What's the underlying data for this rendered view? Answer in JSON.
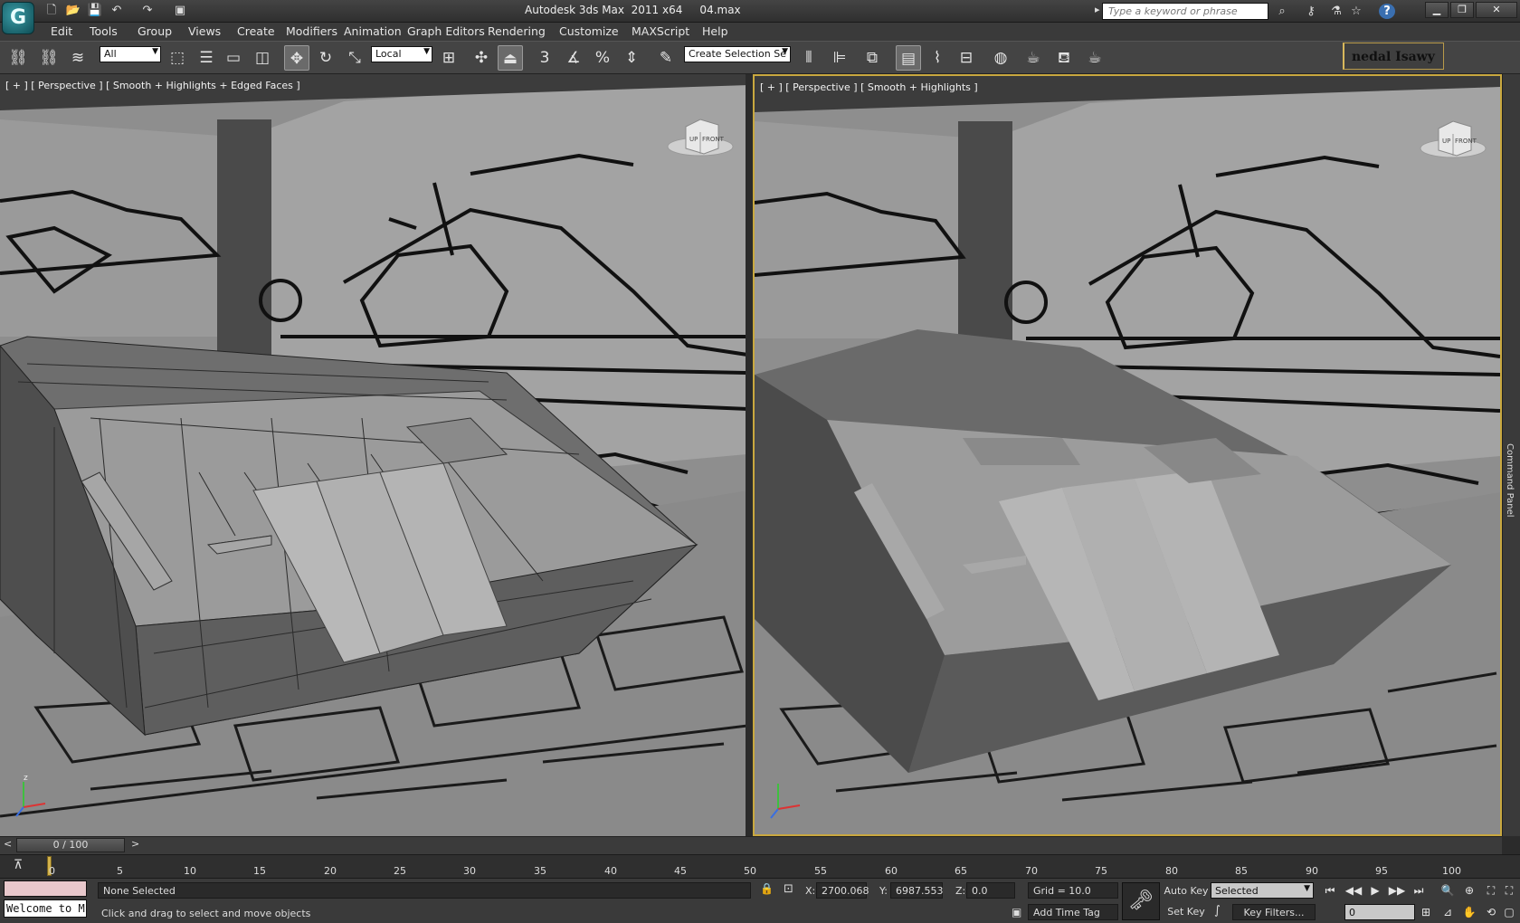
{
  "window": {
    "title": "Autodesk 3ds Max  2011 x64     04.max",
    "search_placeholder": "Type a keyword or phrase",
    "app_logo": "3ds-max-logo"
  },
  "menu": [
    "Edit",
    "Tools",
    "Group",
    "Views",
    "Create",
    "Modifiers",
    "Animation",
    "Graph Editors",
    "Rendering",
    "Customize",
    "MAXScript",
    "Help"
  ],
  "toolbar": {
    "selection_filter": "All",
    "reference_coord": "Local",
    "named_selection": "Create Selection Se",
    "user_label": "nedal Isawy"
  },
  "viewports": {
    "left_label": "[ + ] [ Perspective ] [ Smooth + Highlights + Edged Faces ]",
    "right_label": "[ + ] [ Perspective ] [ Smooth + Highlights ]",
    "viewcube_top": "UP",
    "viewcube_front": "FRONT",
    "axis_z": "z"
  },
  "command_panel_label": "Command Panel",
  "timeline": {
    "current": "0 / 100",
    "ticks": [
      "0",
      "5",
      "10",
      "15",
      "20",
      "25",
      "30",
      "35",
      "40",
      "45",
      "50",
      "55",
      "60",
      "65",
      "70",
      "75",
      "80",
      "85",
      "90",
      "95",
      "100"
    ]
  },
  "status": {
    "maxscript_listener": "Welcome to M",
    "selection": "None Selected",
    "prompt": "Click and drag to select and move objects",
    "x_label": "X:",
    "x_value": "2700.068",
    "y_label": "Y:",
    "y_value": "6987.553",
    "z_label": "Z:",
    "z_value": "0.0",
    "grid": "Grid = 10.0",
    "add_time_tag": "Add Time Tag",
    "auto_key": "Auto Key",
    "set_key": "Set Key",
    "key_mode": "Selected",
    "key_filters": "Key Filters...",
    "frame": "0"
  }
}
